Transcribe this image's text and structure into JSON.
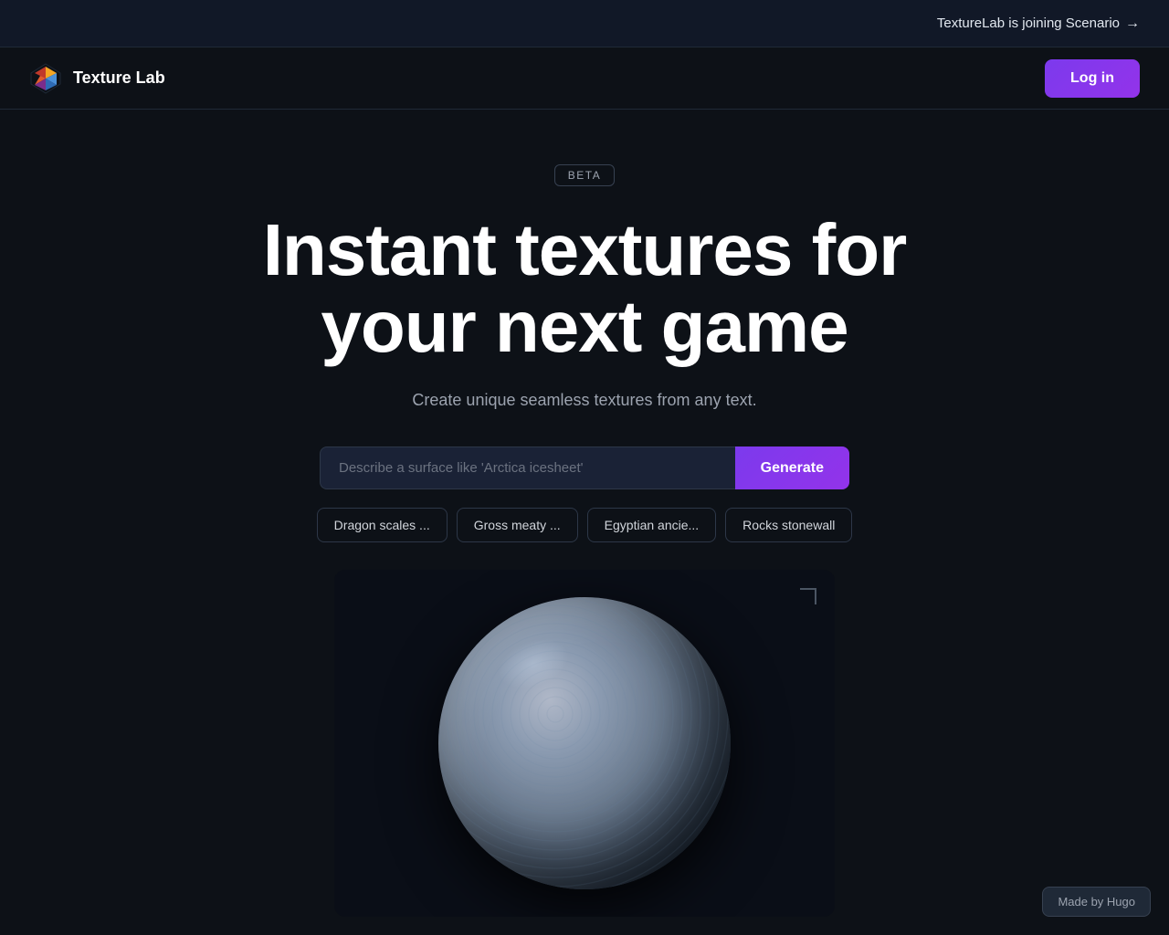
{
  "announcement": {
    "text": "TextureLab is joining Scenario",
    "arrow": "→"
  },
  "navbar": {
    "logo_text": "Texture Lab",
    "login_label": "Log in"
  },
  "hero": {
    "beta_label": "BETA",
    "title_line1": "Instant textures for",
    "title_line2": "your next game",
    "subtitle": "Create unique seamless textures from any text.",
    "input_placeholder": "Describe a surface like 'Arctica icesheet'",
    "generate_label": "Generate"
  },
  "chips": [
    {
      "label": "Dragon scales ..."
    },
    {
      "label": "Gross meaty ..."
    },
    {
      "label": "Egyptian ancie..."
    },
    {
      "label": "Rocks stonewall"
    }
  ],
  "footer": {
    "made_by": "Made by Hugo"
  }
}
